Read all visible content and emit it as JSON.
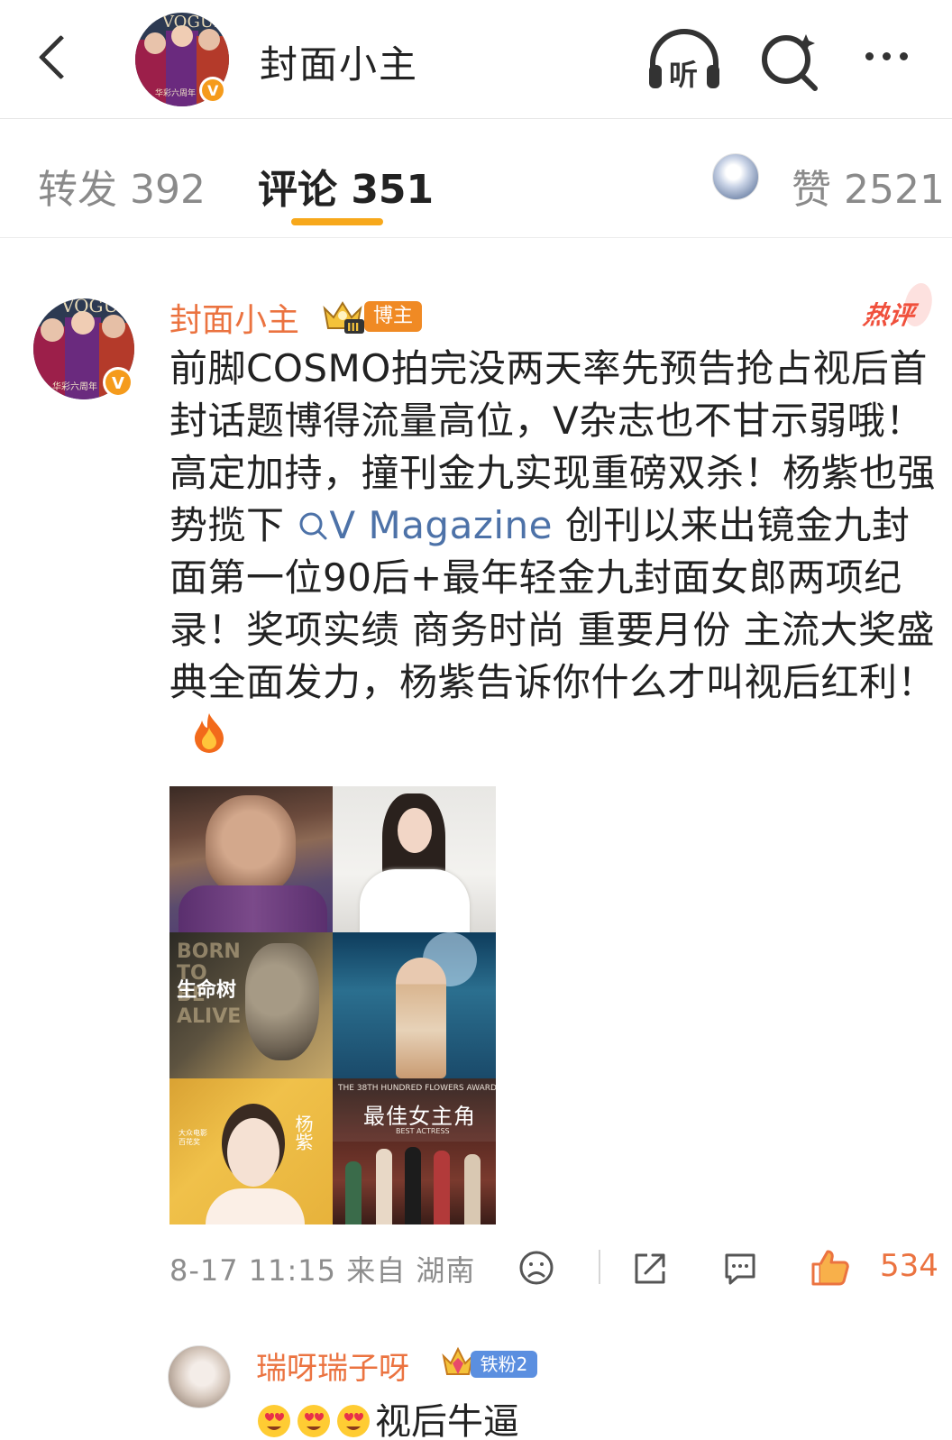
{
  "header": {
    "title": "封面小主",
    "icons": [
      "back-icon",
      "listen-icon",
      "search-icon",
      "more-icon"
    ],
    "listen_label": "听"
  },
  "tabs": {
    "repost": "转发 392",
    "comment": "评论 351",
    "like": "赞 2521",
    "active": "comment",
    "accent": "#f7a81b"
  },
  "comment": {
    "author": "封面小主",
    "badge": "博主",
    "badge_level": "III",
    "hot_tag": "热评",
    "text_before_link": "前脚COSMO拍完没两天率先预告抢占视后首封话题博得流量高位，V杂志也不甘示弱哦！高定加持，撞刊金九实现重磅双杀！杨紫也强势揽下",
    "link_text": "V Magazine",
    "text_after_link": "创刊以来出镜金九封面第一位90后+最年轻金九封面女郎两项纪录！奖项实绩 商务时尚 重要月份 主流大奖盛典全面发力，杨紫告诉你什么才叫视后红利！",
    "link_color": "#4d72a8",
    "author_color": "#eb7340",
    "images": {
      "img3_title": "生命树",
      "img3_en": "BORN\nTO\nBE\nALIVE",
      "img5_name": "杨紫",
      "img5_award": "大众电影\n百花奖",
      "img6_header": "THE 38TH HUNDRED FLOWERS AWARDS",
      "img6_title": "最佳女主角",
      "img6_sub": "BEST ACTRESS"
    },
    "meta": "8-17 11:15  来自 湖南",
    "like_count": "534"
  },
  "reply": {
    "author": "瑞呀瑞子呀",
    "badge": "铁粉2",
    "badge_color": "#5b8fe0",
    "text": "视后牛逼"
  }
}
